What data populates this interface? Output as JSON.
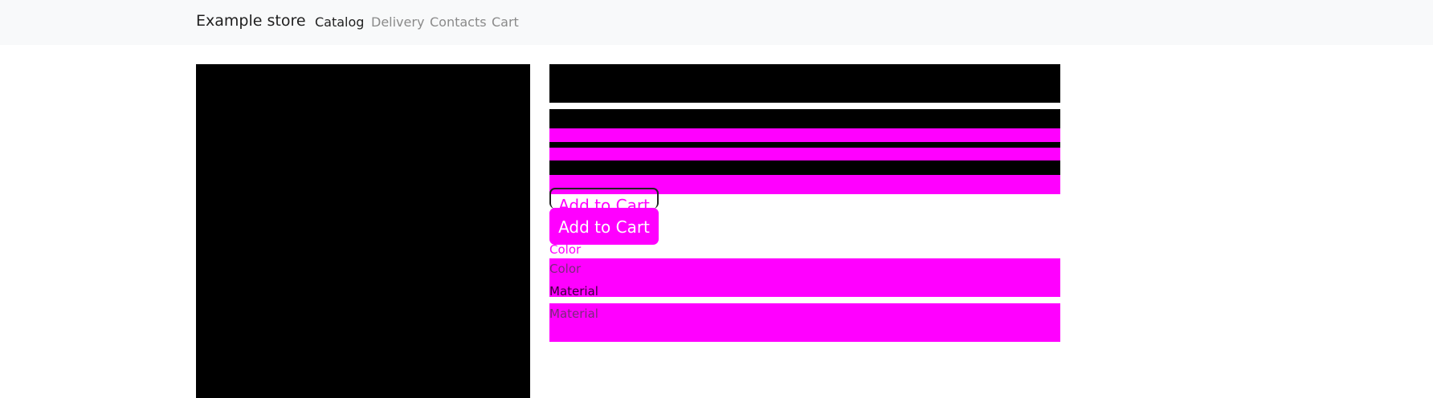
{
  "navbar": {
    "brand": "Example store",
    "links": [
      {
        "label": "Catalog",
        "active": true
      },
      {
        "label": "Delivery",
        "active": false
      },
      {
        "label": "Contacts",
        "active": false
      },
      {
        "label": "Cart",
        "active": false
      }
    ]
  },
  "product": {
    "add_to_cart_label": "Add to Cart",
    "options": {
      "color": {
        "label": "Color",
        "value": "Color"
      },
      "material": {
        "label": "Material",
        "value": "Material"
      }
    }
  },
  "colors": {
    "navbar_bg": "#f8f9fa",
    "placeholder_black": "#000000",
    "missing_texture_magenta": "#ff00ff",
    "button_primary": "#1a7cf5"
  }
}
